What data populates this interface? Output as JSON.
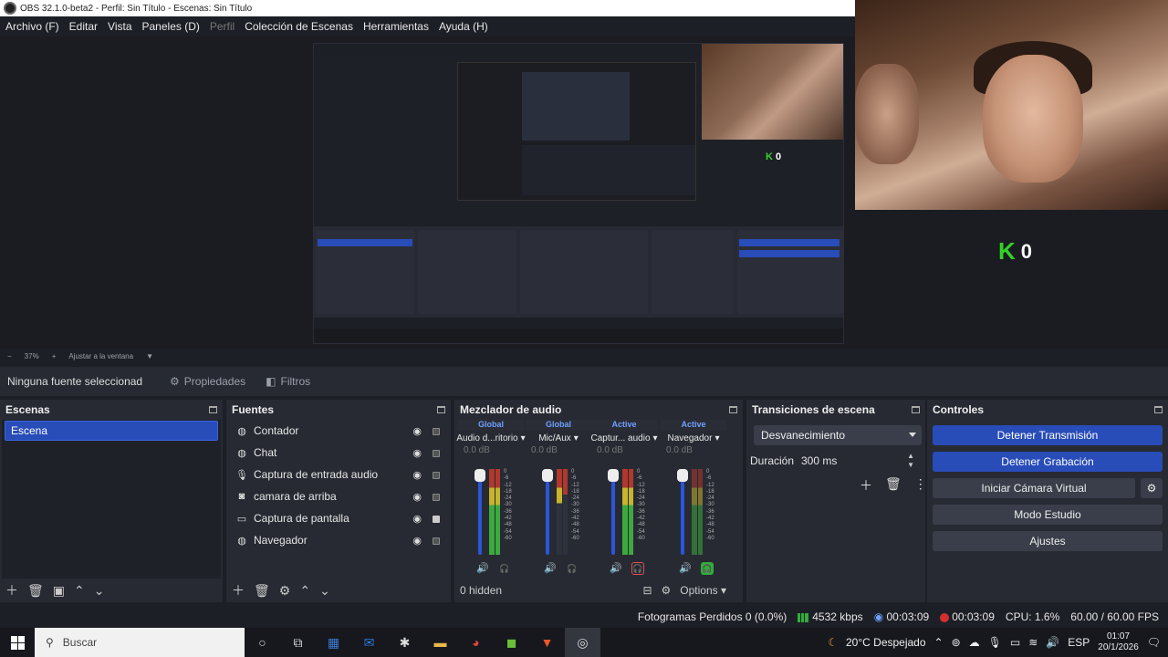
{
  "window": {
    "title": "OBS 32.1.0-beta2 - Perfil: Sin Título - Escenas: Sin Título"
  },
  "menu": [
    {
      "label": "Archivo (F)",
      "enabled": true
    },
    {
      "label": "Editar",
      "enabled": true
    },
    {
      "label": "Vista",
      "enabled": true
    },
    {
      "label": "Paneles (D)",
      "enabled": true
    },
    {
      "label": "Perfil",
      "enabled": false
    },
    {
      "label": "Colección de Escenas",
      "enabled": true
    },
    {
      "label": "Herramientas",
      "enabled": true
    },
    {
      "label": "Ayuda (H)",
      "enabled": true
    }
  ],
  "overlay": {
    "k_icon": "K",
    "count": "0"
  },
  "zoombar": {
    "zoom": "37%",
    "fit": "Ajustar a la ventana"
  },
  "properties_bar": {
    "selection": "Ninguna fuente seleccionad",
    "properties_label": "Propiedades",
    "filters_label": "Filtros"
  },
  "scenes": {
    "title": "Escenas",
    "items": [
      {
        "label": "Escena",
        "selected": true
      }
    ]
  },
  "sources": {
    "title": "Fuentes",
    "items": [
      {
        "label": "Contador",
        "icon": "globe-icon",
        "visible": true,
        "locked": false
      },
      {
        "label": "Chat",
        "icon": "globe-icon",
        "visible": true,
        "locked": false
      },
      {
        "label": "Captura de entrada audio",
        "icon": "microphone-icon",
        "visible": true,
        "locked": false
      },
      {
        "label": "camara de arriba",
        "icon": "camera-icon",
        "visible": true,
        "locked": false
      },
      {
        "label": "Captura de pantalla",
        "icon": "monitor-icon",
        "visible": true,
        "locked": true
      },
      {
        "label": "Navegador",
        "icon": "globe-icon",
        "visible": true,
        "locked": false
      }
    ]
  },
  "mixer": {
    "title": "Mezclador de audio",
    "channels": [
      {
        "badge": "Global",
        "name": "Audio d...ritorio",
        "db": "0.0 dB",
        "headphones_on": false
      },
      {
        "badge": "Global",
        "name": "Mic/Aux",
        "db": "0.0 dB",
        "headphones_on": false
      },
      {
        "badge": "Active",
        "name": "Captur... audio",
        "db": "0.0 dB",
        "headphones_on": false
      },
      {
        "badge": "Active",
        "name": "Navegador",
        "db": "0.0 dB",
        "headphones_on": true
      }
    ],
    "scale": [
      "0",
      "-6",
      "-12",
      "-18",
      "-24",
      "-30",
      "-36",
      "-42",
      "-48",
      "-54",
      "-60"
    ],
    "hidden_label": "0 hidden",
    "options_label": "Options"
  },
  "transitions": {
    "title": "Transiciones de escena",
    "selected": "Desvanecimiento",
    "duration_label": "Duración",
    "duration_value": "300 ms"
  },
  "controls": {
    "title": "Controles",
    "stop_stream": "Detener Transmisión",
    "stop_record": "Detener Grabación",
    "virtual_cam": "Iniciar Cámara Virtual",
    "studio_mode": "Modo Estudio",
    "settings": "Ajustes"
  },
  "status": {
    "dropped": "Fotogramas Perdidos 0 (0.0%)",
    "bitrate": "4532 kbps",
    "stream_time": "00:03:09",
    "record_time": "00:03:09",
    "cpu": "CPU: 1.6%",
    "fps": "60.00 / 60.00 FPS"
  },
  "taskbar": {
    "search": "Buscar",
    "weather": "20°C Despejado",
    "lang": "ESP",
    "time": "01:07",
    "date": "20/1/2026"
  },
  "colors": {
    "accent": "#284cb8",
    "k_green": "#33d126",
    "meter_green": "#3fb83f"
  }
}
